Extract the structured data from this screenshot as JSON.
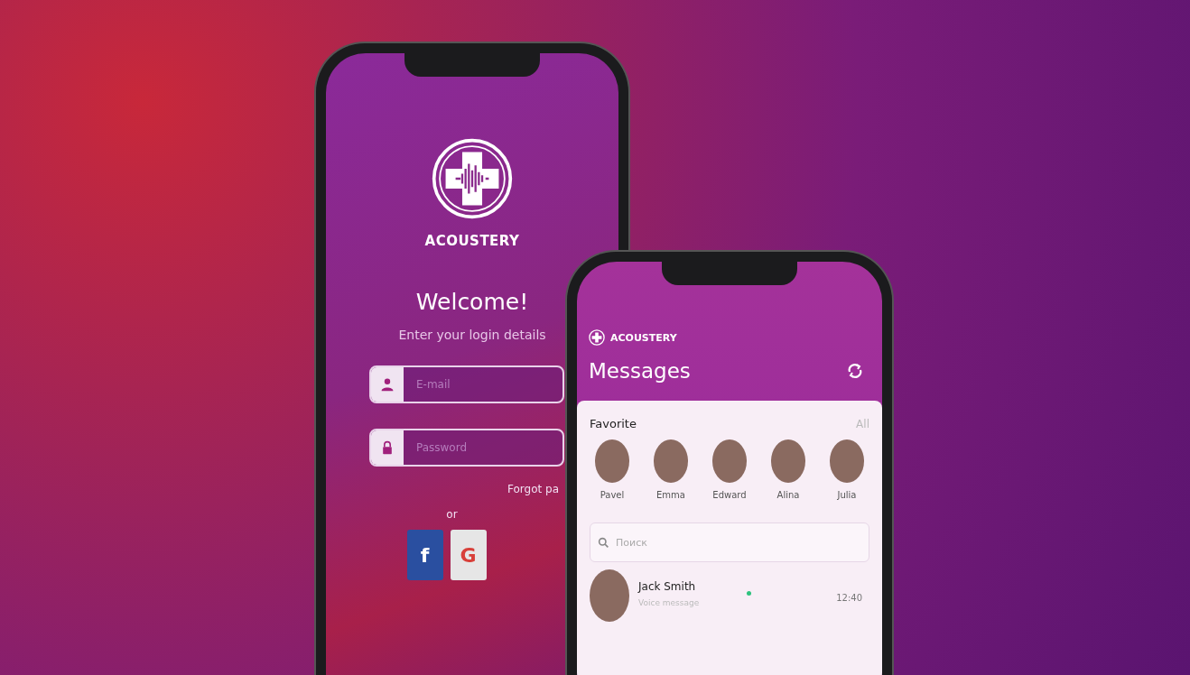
{
  "login_screen": {
    "brand": "ACOUSTERY",
    "title": "Welcome!",
    "subtitle": "Enter your login details",
    "fields": [
      {
        "kind": "email",
        "placeholder": "E-mail"
      },
      {
        "kind": "password",
        "placeholder": "Password"
      }
    ],
    "forgot_link": "Forgot pa",
    "separator": "or",
    "social_buttons": [
      {
        "kind": "facebook",
        "label": "f"
      },
      {
        "kind": "google",
        "label": "G"
      }
    ]
  },
  "messages_screen": {
    "brand": "ACOUSTERY",
    "title": "Messages",
    "favorites_title": "Favorite",
    "all_link": "All",
    "favorites": [
      {
        "name": "Pavel"
      },
      {
        "name": "Emma"
      },
      {
        "name": "Edward"
      },
      {
        "name": "Alina"
      },
      {
        "name": "Julia"
      }
    ],
    "search": {
      "placeholder": "Поиск"
    },
    "conversations": [
      {
        "name": "Jack Smith",
        "preview": "Voice message",
        "time": "12:40",
        "online": true
      }
    ]
  }
}
